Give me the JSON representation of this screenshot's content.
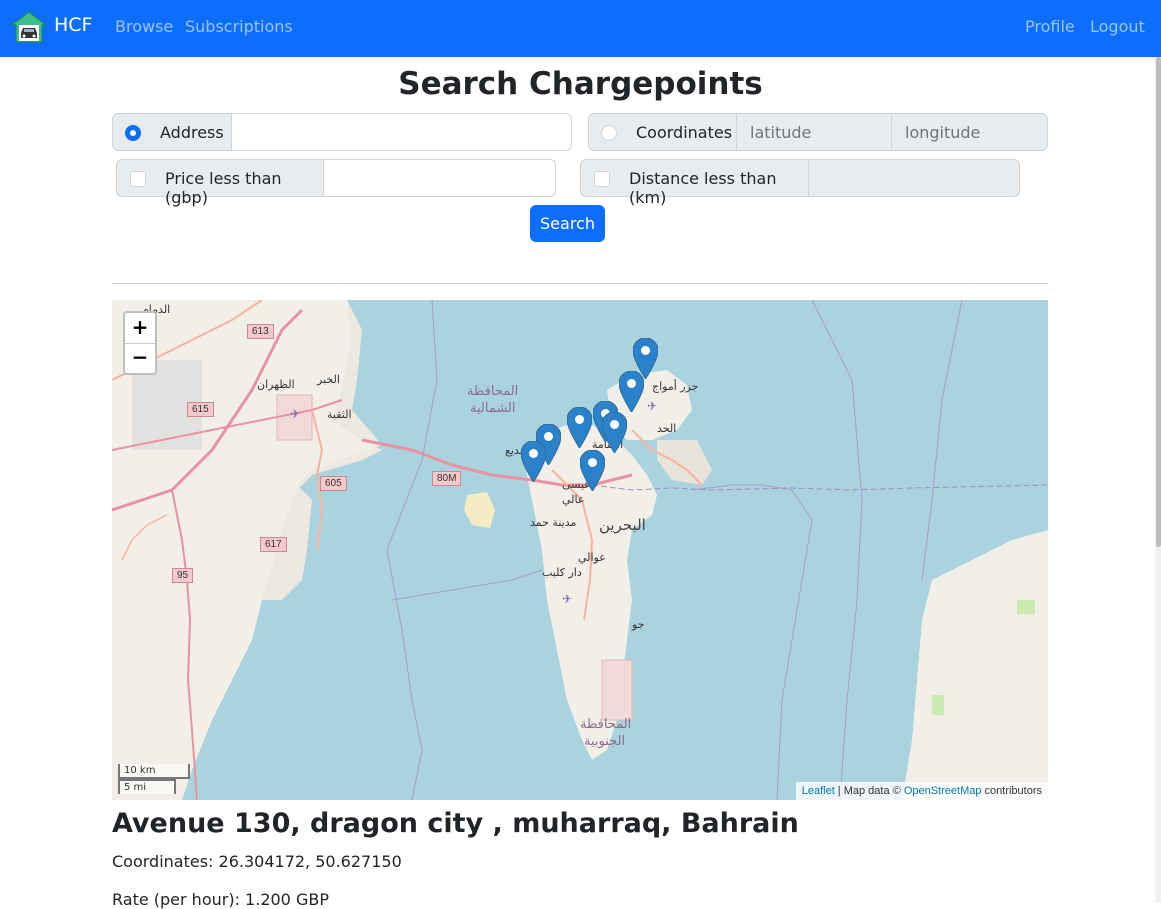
{
  "navbar": {
    "brand": "HCF",
    "links": [
      "Browse",
      "Subscriptions"
    ],
    "right_links": [
      "Profile",
      "Logout"
    ],
    "bg_color": "#0d6efd"
  },
  "page_title": "Search Chargepoints",
  "form": {
    "address_label": "Address",
    "address_value": "",
    "address_selected": true,
    "coordinates_label": "Coordinates",
    "coordinates_selected": false,
    "latitude_placeholder": "latitude",
    "longitude_placeholder": "longitude",
    "price_label": "Price less than (gbp)",
    "price_checked": false,
    "price_value": "",
    "distance_label": "Distance less than (km)",
    "distance_checked": false,
    "distance_value": "",
    "search_button": "Search"
  },
  "map": {
    "zoom_in": "+",
    "zoom_out": "−",
    "scale_km": "10 km",
    "scale_mi": "5 mi",
    "attribution": {
      "leaflet": "Leaflet",
      "sep": " | Map data © ",
      "osm": "OpenStreetMap",
      "tail": " contributors"
    },
    "labels": {
      "dammam": "الدمام",
      "dhahran": "الظهران",
      "khobar": "الخبر",
      "thuqbah": "الثقبة",
      "northern1": "المحافظة",
      "northern2": "الشمالية",
      "amwaj": "جزر أمواج",
      "hidd": "الحد",
      "manama": "المنامة",
      "budaiya": "البديع",
      "isa": "عيسى",
      "aali": "عالي",
      "hamad": "مدينة حمد",
      "bahrain": "البحرين",
      "awali": "عوالي",
      "darkulaib": "دار كليب",
      "jaw": "جو",
      "southern1": "المحافظة",
      "southern2": "الجنوبية"
    },
    "road_shields": [
      "613",
      "615",
      "605",
      "617",
      "95",
      "80M"
    ],
    "marker_count": 9,
    "marker_color": "#2b82cb"
  },
  "result": {
    "title": "Avenue 130, dragon city , muharraq, Bahrain",
    "coordinates": "Coordinates: 26.304172, 50.627150",
    "rate": "Rate (per hour): 1.200 GBP"
  }
}
